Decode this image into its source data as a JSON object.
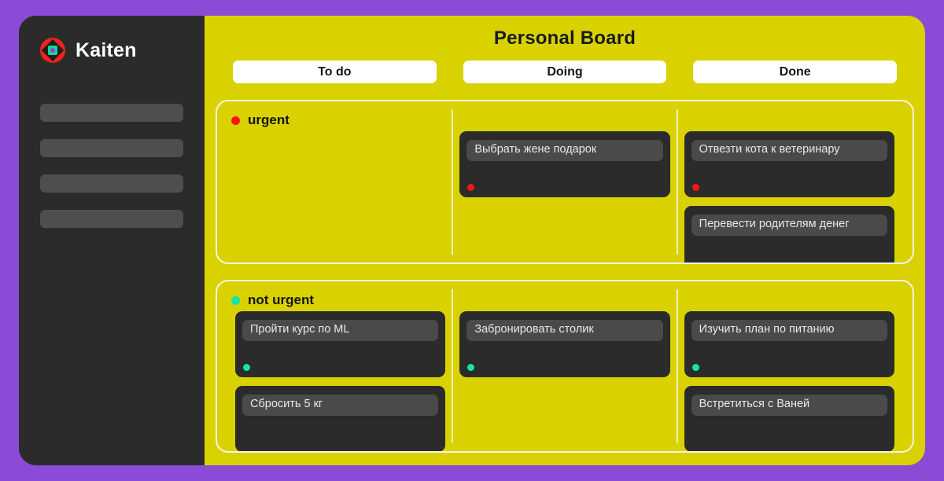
{
  "theme": {
    "page_background": "#8B4BD6",
    "board_background": "#D9D200",
    "sidebar_background": "#2B2B2B",
    "card_background": "#2B2B2B",
    "card_title_background": "#4A4A4A",
    "lane_border": "#F7F4E3",
    "urgent_color": "#FF1414",
    "not_urgent_color": "#12E6A8"
  },
  "sidebar": {
    "brand": "Kaiten",
    "logo_icon": "kaiten-logo-icon",
    "nav_placeholders": [
      "",
      "",
      "",
      ""
    ]
  },
  "board": {
    "title": "Personal Board",
    "columns": [
      {
        "label": "To do"
      },
      {
        "label": "Doing"
      },
      {
        "label": "Done"
      }
    ],
    "swimlanes": [
      {
        "label": "urgent",
        "dot_color": "#FF1414",
        "priority": "urgent",
        "columns": [
          {
            "column": "To do",
            "cards": []
          },
          {
            "column": "Doing",
            "cards": [
              {
                "title": "Выбрать жене подарок",
                "dot": "urgent"
              }
            ]
          },
          {
            "column": "Done",
            "cards": [
              {
                "title": "Отвезти кота к ветеринару",
                "dot": "urgent"
              },
              {
                "title": "Перевести родителям денег",
                "dot": "none"
              }
            ]
          }
        ]
      },
      {
        "label": "not urgent",
        "dot_color": "#12E6A8",
        "priority": "not-urgent",
        "columns": [
          {
            "column": "To do",
            "cards": [
              {
                "title": "Пройти курс по ML",
                "dot": "not-urgent"
              },
              {
                "title": "Сбросить 5 кг",
                "dot": "none"
              }
            ]
          },
          {
            "column": "Doing",
            "cards": [
              {
                "title": "Забронировать столик",
                "dot": "not-urgent"
              }
            ]
          },
          {
            "column": "Done",
            "cards": [
              {
                "title": "Изучить план по питанию",
                "dot": "not-urgent"
              },
              {
                "title": "Встретиться с Ваней",
                "dot": "none"
              }
            ]
          }
        ]
      }
    ]
  }
}
